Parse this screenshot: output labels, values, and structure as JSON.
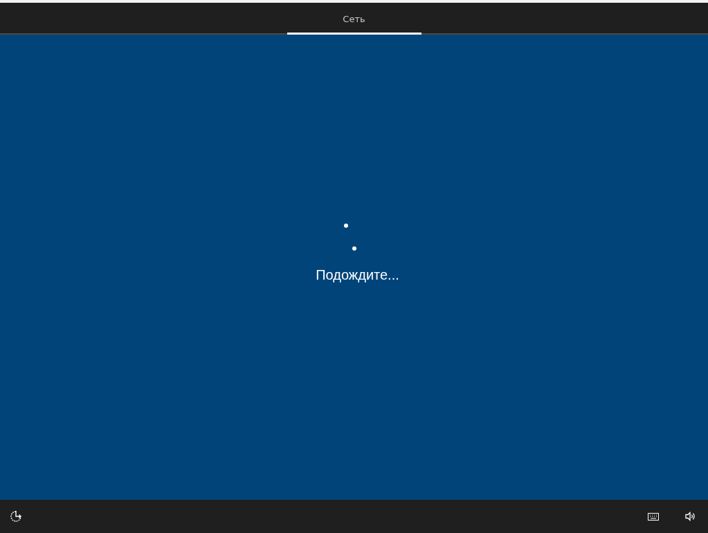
{
  "tabs": [
    {
      "label": "Сеть",
      "selected": true
    }
  ],
  "status": {
    "message": "Подождите..."
  }
}
